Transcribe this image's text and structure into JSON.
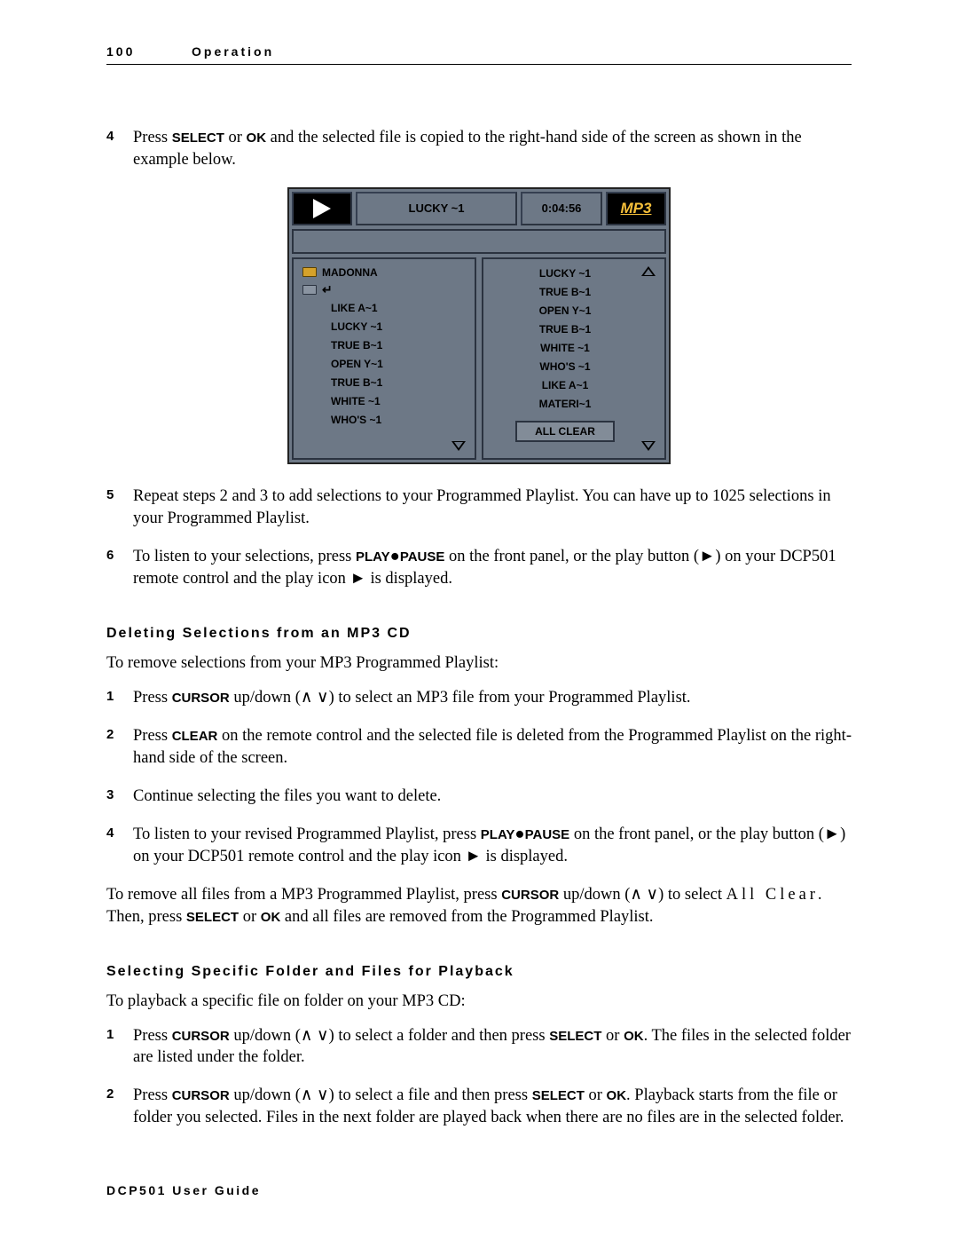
{
  "header": {
    "page": "100",
    "section": "Operation"
  },
  "steps_a": [
    {
      "num": "4",
      "parts": [
        {
          "t": "Press "
        },
        {
          "t": "SELECT",
          "b": true
        },
        {
          "t": " or "
        },
        {
          "t": "OK",
          "b": true
        },
        {
          "t": " and the selected file is copied to the right-hand side of the screen as shown in the example below."
        }
      ]
    }
  ],
  "device": {
    "title": "LUCKY ~1",
    "time": "0:04:56",
    "logo": "MP3",
    "folder": "MADONNA",
    "left_tracks": [
      "LIKE A~1",
      "LUCKY ~1",
      "TRUE B~1",
      "OPEN Y~1",
      "TRUE B~1",
      "WHITE ~1",
      "WHO'S ~1"
    ],
    "right_tracks": [
      "LUCKY ~1",
      "TRUE B~1",
      "OPEN Y~1",
      "TRUE B~1",
      "WHITE ~1",
      "WHO'S ~1",
      "LIKE A~1",
      "MATERI~1"
    ],
    "all_clear": "ALL CLEAR"
  },
  "steps_b": [
    {
      "num": "5",
      "parts": [
        {
          "t": "Repeat steps 2 and 3 to add selections to your Programmed Playlist. You can have up to 1025 selections in your Programmed Playlist."
        }
      ]
    },
    {
      "num": "6",
      "parts": [
        {
          "t": "To listen to your selections, press "
        },
        {
          "t": "PLAY",
          "b": true
        },
        {
          "t": "●",
          "raw": true
        },
        {
          "t": "PAUSE",
          "b": true
        },
        {
          "t": " on the front panel, or the play button (►) on your DCP501 remote control and the play icon ► is displayed."
        }
      ]
    }
  ],
  "heading1": "Deleting Selections from an MP3 CD",
  "para1": "To remove selections from your MP3 Programmed Playlist:",
  "del_steps": [
    {
      "num": "1",
      "parts": [
        {
          "t": "Press "
        },
        {
          "t": "CURSOR",
          "b": true
        },
        {
          "t": " up/down (∧ ∨) to select an MP3 file from your Programmed Playlist."
        }
      ]
    },
    {
      "num": "2",
      "parts": [
        {
          "t": "Press "
        },
        {
          "t": "CLEAR",
          "b": true
        },
        {
          "t": " on the remote control and the selected file is deleted from the Programmed Playlist on the right-hand side of the screen."
        }
      ]
    },
    {
      "num": "3",
      "parts": [
        {
          "t": "Continue selecting the files you want to delete."
        }
      ]
    },
    {
      "num": "4",
      "parts": [
        {
          "t": "To listen to your revised Programmed Playlist, press "
        },
        {
          "t": "PLAY",
          "b": true
        },
        {
          "t": "●",
          "raw": true
        },
        {
          "t": "PAUSE",
          "b": true
        },
        {
          "t": " on the front panel, or the play button (►) on your DCP501 remote control and the play icon ► is displayed."
        }
      ]
    }
  ],
  "para2_parts": [
    {
      "t": "To remove all files from a MP3 Programmed Playlist, press "
    },
    {
      "t": "CURSOR",
      "b": true
    },
    {
      "t": " up/down (∧ ∨) to select "
    },
    {
      "t": "All Clear.",
      "spaced": true
    },
    {
      "t": " Then, press "
    },
    {
      "t": "SELECT",
      "b": true
    },
    {
      "t": " or "
    },
    {
      "t": "OK",
      "b": true
    },
    {
      "t": " and all files are removed from the Programmed Playlist."
    }
  ],
  "heading2": "Selecting Specific Folder and Files for Playback",
  "para3": "To playback a specific file on folder on your MP3 CD:",
  "sel_steps": [
    {
      "num": "1",
      "parts": [
        {
          "t": "Press "
        },
        {
          "t": "CURSOR",
          "b": true
        },
        {
          "t": " up/down (∧ ∨) to select a folder and then press "
        },
        {
          "t": "SELECT",
          "b": true
        },
        {
          "t": " or "
        },
        {
          "t": "OK",
          "b": true
        },
        {
          "t": ". The files in the selected folder are listed under the folder."
        }
      ]
    },
    {
      "num": "2",
      "parts": [
        {
          "t": "Press "
        },
        {
          "t": "CURSOR",
          "b": true
        },
        {
          "t": " up/down (∧ ∨) to select a file and then press "
        },
        {
          "t": "SELECT",
          "b": true
        },
        {
          "t": " or "
        },
        {
          "t": "OK",
          "b": true
        },
        {
          "t": ". Playback starts from the file or folder you selected. Files in the next folder are played back when there are no files are in the selected folder."
        }
      ]
    }
  ],
  "footer": "DCP501 User Guide"
}
